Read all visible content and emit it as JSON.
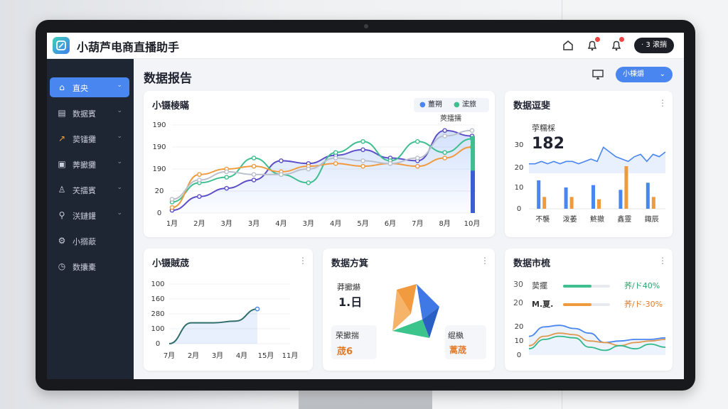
{
  "app": {
    "title": "小葫芦电商直播助手",
    "account_label": "· 3 滚揣"
  },
  "topbar": {
    "icons": [
      "home-icon",
      "bell-icon",
      "notification-icon"
    ]
  },
  "sidebar": {
    "items": [
      {
        "label": "直央",
        "icon": "home-icon",
        "active": true
      },
      {
        "label": "数据賓",
        "icon": "bar-icon",
        "active": false
      },
      {
        "label": "荬镭攤",
        "icon": "trend-icon",
        "active": false
      },
      {
        "label": "莾擨攤",
        "icon": "doc-icon",
        "active": false
      },
      {
        "label": "芖擂賓",
        "icon": "user-icon",
        "active": false
      },
      {
        "label": "浂鏈鑵",
        "icon": "analysis-icon",
        "active": false
      },
      {
        "label": "小搦藃",
        "icon": "gear-icon",
        "active": false
      },
      {
        "label": "数攮橐",
        "icon": "clock-icon",
        "active": false
      }
    ]
  },
  "page": {
    "title": "数据报告",
    "button_label": "小棅爝"
  },
  "cards": {
    "main": {
      "title": "小镊棱瞞",
      "legend": [
        "薑朔",
        "浤旅"
      ],
      "annotation": "莢擂擩"
    },
    "trend": {
      "title": "数据逗斐",
      "metric_label": "荢糯棌",
      "metric_value": "182"
    },
    "small": {
      "title": "小镊賊荿"
    },
    "plan": {
      "title": "数据方箕",
      "stat1_label": "莽擨爀",
      "stat1_value": "1.日",
      "stat2_label": "荣擨揣",
      "stat2_value": "荿6",
      "stat3_label": "绲槸",
      "stat3_value": "蒿荿"
    },
    "market": {
      "title": "数据市梳",
      "row1_label": "荬擺",
      "row1_value": "荞/ド40%",
      "row2_label": "M.夏.",
      "row2_value": "荞/ド-30%",
      "y_ticks": [
        "30",
        "20",
        "20",
        "10",
        "0"
      ]
    }
  },
  "chart_data": [
    {
      "type": "line",
      "title": "小镊棱瞞",
      "categories": [
        "1月",
        "2月",
        "3月",
        "3月",
        "4月",
        "3月",
        "4月",
        "5月",
        "6月",
        "7月",
        "8月",
        "10月"
      ],
      "y_ticks": [
        "190",
        "190",
        "190",
        "20",
        "0"
      ],
      "series": [
        {
          "name": "薑朔",
          "color": "#5b4ec7",
          "values": [
            5,
            30,
            45,
            60,
            95,
            90,
            105,
            115,
            100,
            95,
            150,
            140
          ]
        },
        {
          "name": "浤旅",
          "color": "#3fbf8f",
          "values": [
            20,
            55,
            65,
            100,
            70,
            55,
            110,
            130,
            95,
            130,
            110,
            135
          ]
        },
        {
          "color": "#f09a3e",
          "values": [
            10,
            70,
            80,
            85,
            75,
            85,
            90,
            85,
            90,
            85,
            100,
            120
          ]
        },
        {
          "color": "#b9c0cc",
          "values": [
            25,
            60,
            75,
            70,
            70,
            80,
            100,
            95,
            90,
            100,
            140,
            150
          ]
        }
      ],
      "end_bar": {
        "value": 140
      }
    },
    {
      "type": "bar",
      "title": "数据逗斐",
      "y_ticks": [
        "30",
        "20",
        "10",
        "0"
      ],
      "categories": [
        "不襲",
        "泼萎",
        "鮗撤",
        "鑫靈",
        "鋷辰"
      ],
      "series": [
        {
          "color": "#4a86f0",
          "values": [
            12,
            9,
            10,
            8,
            11
          ]
        },
        {
          "color": "#f09a3e",
          "values": [
            5,
            5,
            4,
            18,
            5
          ]
        }
      ],
      "sparkline": [
        19,
        19,
        20,
        19,
        20,
        19,
        20,
        20,
        19,
        20,
        21,
        20,
        26,
        24,
        22,
        21,
        20,
        22,
        23,
        20,
        23,
        22,
        24
      ]
    },
    {
      "type": "line",
      "title": "小镊賊荿",
      "categories": [
        "7月",
        "2月",
        "3月",
        "4月",
        "15月",
        "11月"
      ],
      "y_ticks": [
        "100",
        "160",
        "280",
        "100",
        "0"
      ],
      "series": [
        {
          "color": "#2f6d6a",
          "values": [
            0,
            60,
            60,
            65,
            100,
            170
          ]
        }
      ]
    },
    {
      "type": "line",
      "title": "数据市梳",
      "y_ticks": [
        "20",
        "10",
        "0"
      ],
      "series": [
        {
          "color": "#4a86f0",
          "values": [
            12,
            18,
            19,
            17,
            14,
            8,
            9,
            10,
            10,
            11
          ]
        },
        {
          "color": "#f09a3e",
          "values": [
            6,
            12,
            14,
            13,
            9,
            8,
            6,
            8,
            9,
            10
          ]
        },
        {
          "color": "#2fbf7f",
          "values": [
            4,
            10,
            12,
            11,
            5,
            3,
            6,
            4,
            7,
            5
          ]
        }
      ]
    }
  ]
}
